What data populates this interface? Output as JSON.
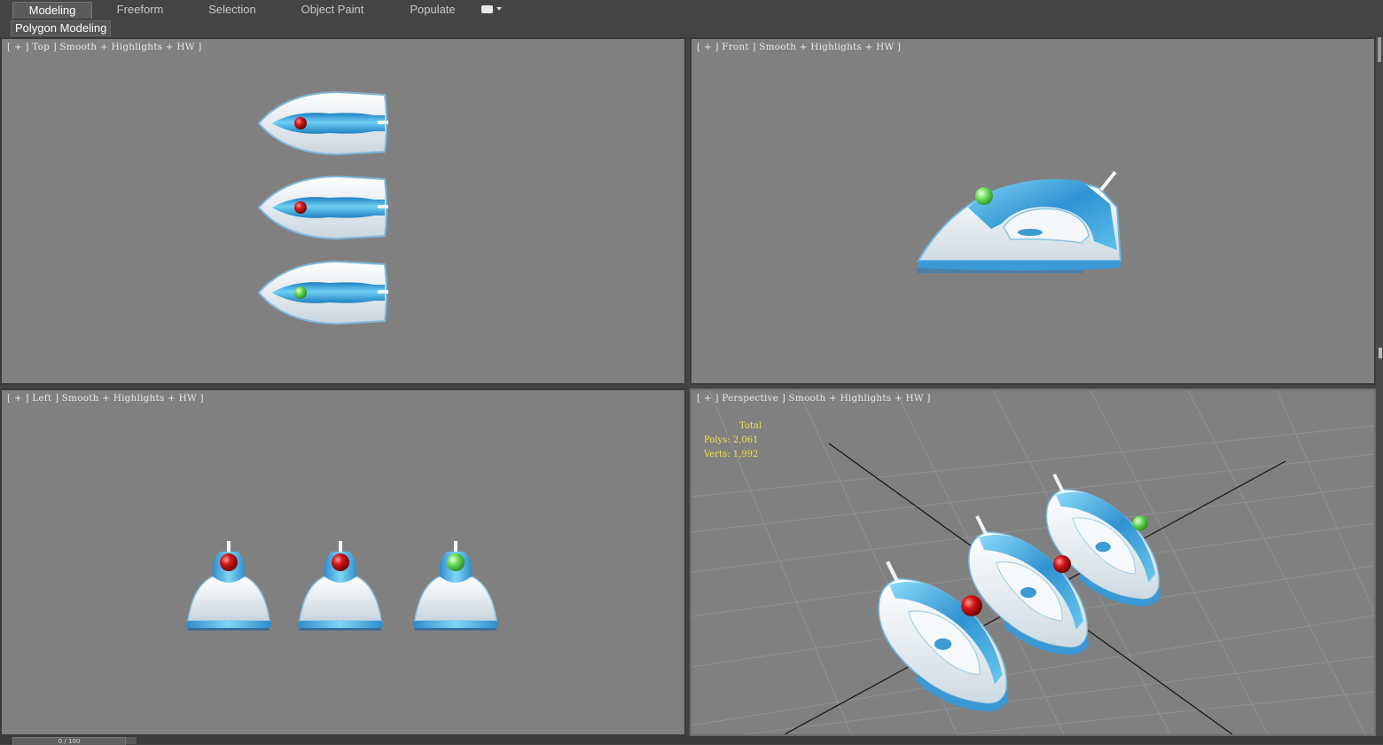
{
  "ribbon": {
    "tabs": [
      {
        "label": "Modeling",
        "active": true
      },
      {
        "label": "Freeform",
        "active": false
      },
      {
        "label": "Selection",
        "active": false
      },
      {
        "label": "Object Paint",
        "active": false
      },
      {
        "label": "Populate",
        "active": false
      }
    ],
    "options_icon": "ribbon-options-dropdown-icon",
    "panel_label": "Polygon Modeling"
  },
  "viewports": {
    "top": {
      "label": "[ + ] Top ] Smooth + Highlights + HW ]"
    },
    "front": {
      "label": "[ + ] Front ] Smooth + Highlights + HW ]"
    },
    "left": {
      "label": "[ + ] Left ] Smooth + Highlights + HW ]"
    },
    "perspective": {
      "label": "[ + ] Perspective ] Smooth + Highlights + HW ]"
    }
  },
  "stats": {
    "title": "Total",
    "polys": "Polys: 2,061",
    "verts": "Verts: 1,992"
  },
  "time_slider": {
    "value": "0 / 100"
  },
  "colors": {
    "viewport_bg": "#808080",
    "ui_bg": "#444444",
    "iron_blue": "#3aa0d8",
    "iron_white": "#eef3f6",
    "knob_red": "#c81e1e",
    "knob_green": "#5fe05a",
    "stats_text": "#f0e050"
  },
  "scene": {
    "object": "steam iron",
    "count": 3,
    "knob_colors": [
      "red",
      "red",
      "green"
    ]
  }
}
